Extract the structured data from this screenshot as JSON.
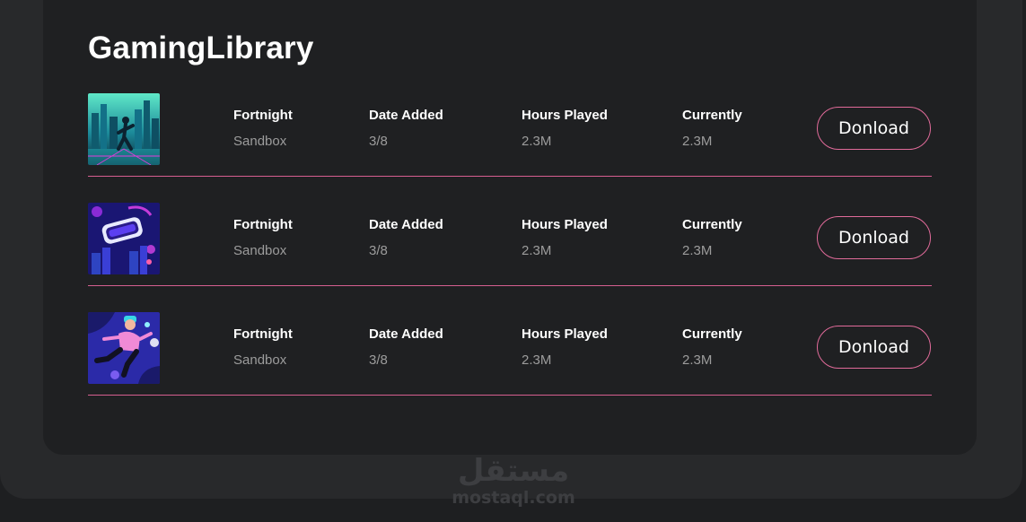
{
  "library": {
    "title": "GamingLibrary",
    "rows": [
      {
        "image": "neon-city-dancer-image",
        "name": "Fortnight",
        "genre": "Sandbox",
        "date_label": "Date Added",
        "date_value": "3/8",
        "hours_label": "Hours Played",
        "hours_value": "2.3M",
        "current_label": "Currently",
        "current_value": "2.3M",
        "button_label": "Donload"
      },
      {
        "image": "vr-headset-image",
        "name": "Fortnight",
        "genre": "Sandbox",
        "date_label": "Date Added",
        "date_value": "3/8",
        "hours_label": "Hours Played",
        "hours_value": "2.3M",
        "current_label": "Currently",
        "current_value": "2.3M",
        "button_label": "Donload"
      },
      {
        "image": "floating-vr-player-image",
        "name": "Fortnight",
        "genre": "Sandbox",
        "date_label": "Date Added",
        "date_value": "3/8",
        "hours_label": "Hours Played",
        "hours_value": "2.3M",
        "current_label": "Currently",
        "current_value": "2.3M",
        "button_label": "Donload"
      }
    ]
  },
  "watermark": {
    "arabic": "مستقل",
    "latin": "mostaql.com"
  },
  "colors": {
    "accent": "#e16b9a",
    "panel": "#1f2022",
    "frame": "#28292b",
    "background": "#1e1f21",
    "muted_text": "#9c9c9c"
  }
}
